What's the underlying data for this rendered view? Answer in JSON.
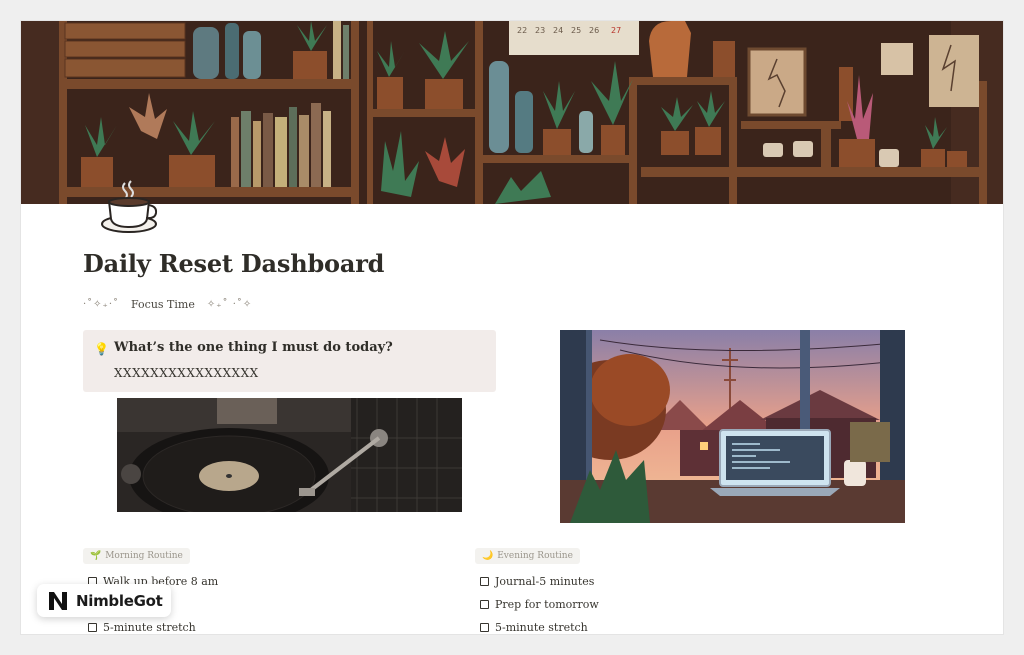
{
  "page": {
    "title": "Daily Reset Dashboard",
    "focus_prefix": "·˚✧₊·˚",
    "focus_label": "Focus Time",
    "focus_suffix": "✧₊˚ ·˚✧"
  },
  "callout": {
    "icon": "lightbulb-icon",
    "question": "What’s the one thing I must do today?",
    "answer": "XXXXXXXXXXXXXXXX"
  },
  "routines": {
    "morning": {
      "label": "Morning Routine",
      "icon": "sprout-icon",
      "items": [
        {
          "text": "Walk up before 8 am",
          "checked": false
        },
        {
          "text": "",
          "checked": false
        },
        {
          "text": "5-minute stretch",
          "checked": false
        }
      ]
    },
    "evening": {
      "label": "Evening Routine",
      "icon": "moon-icon",
      "items": [
        {
          "text": "Journal-5 minutes",
          "checked": false
        },
        {
          "text": "Prep for tomorrow",
          "checked": false
        },
        {
          "text": "5-minute stretch",
          "checked": false
        }
      ]
    }
  },
  "watermark": {
    "brand": "NimbleGot"
  },
  "colors": {
    "callout_bg": "#f2ecea",
    "tag_bg": "#f3f2ef",
    "text": "#37352f"
  }
}
